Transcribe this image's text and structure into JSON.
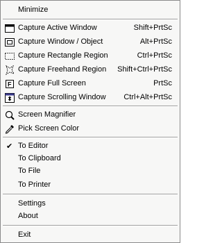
{
  "menu": {
    "minimize": {
      "label": "Minimize"
    },
    "capture": [
      {
        "label": "Capture Active Window",
        "shortcut": "Shift+PrtSc",
        "icon": "active-window-icon"
      },
      {
        "label": "Capture Window / Object",
        "shortcut": "Alt+PrtSc",
        "icon": "window-object-icon"
      },
      {
        "label": "Capture Rectangle Region",
        "shortcut": "Ctrl+PrtSc",
        "icon": "rectangle-region-icon"
      },
      {
        "label": "Capture Freehand Region",
        "shortcut": "Shift+Ctrl+PrtSc",
        "icon": "freehand-region-icon"
      },
      {
        "label": "Capture Full Screen",
        "shortcut": "PrtSc",
        "icon": "full-screen-icon"
      },
      {
        "label": "Capture Scrolling Window",
        "shortcut": "Ctrl+Alt+PrtSc",
        "icon": "scrolling-window-icon"
      }
    ],
    "tools": [
      {
        "label": "Screen Magnifier",
        "icon": "magnifier-icon"
      },
      {
        "label": "Pick Screen Color",
        "icon": "eyedropper-icon"
      }
    ],
    "output": [
      {
        "label": "To Editor",
        "checked": true
      },
      {
        "label": "To Clipboard",
        "checked": false
      },
      {
        "label": "To File",
        "checked": false
      },
      {
        "label": "To Printer",
        "checked": false
      }
    ],
    "settings": {
      "label": "Settings"
    },
    "about": {
      "label": "About"
    },
    "exit": {
      "label": "Exit"
    }
  }
}
